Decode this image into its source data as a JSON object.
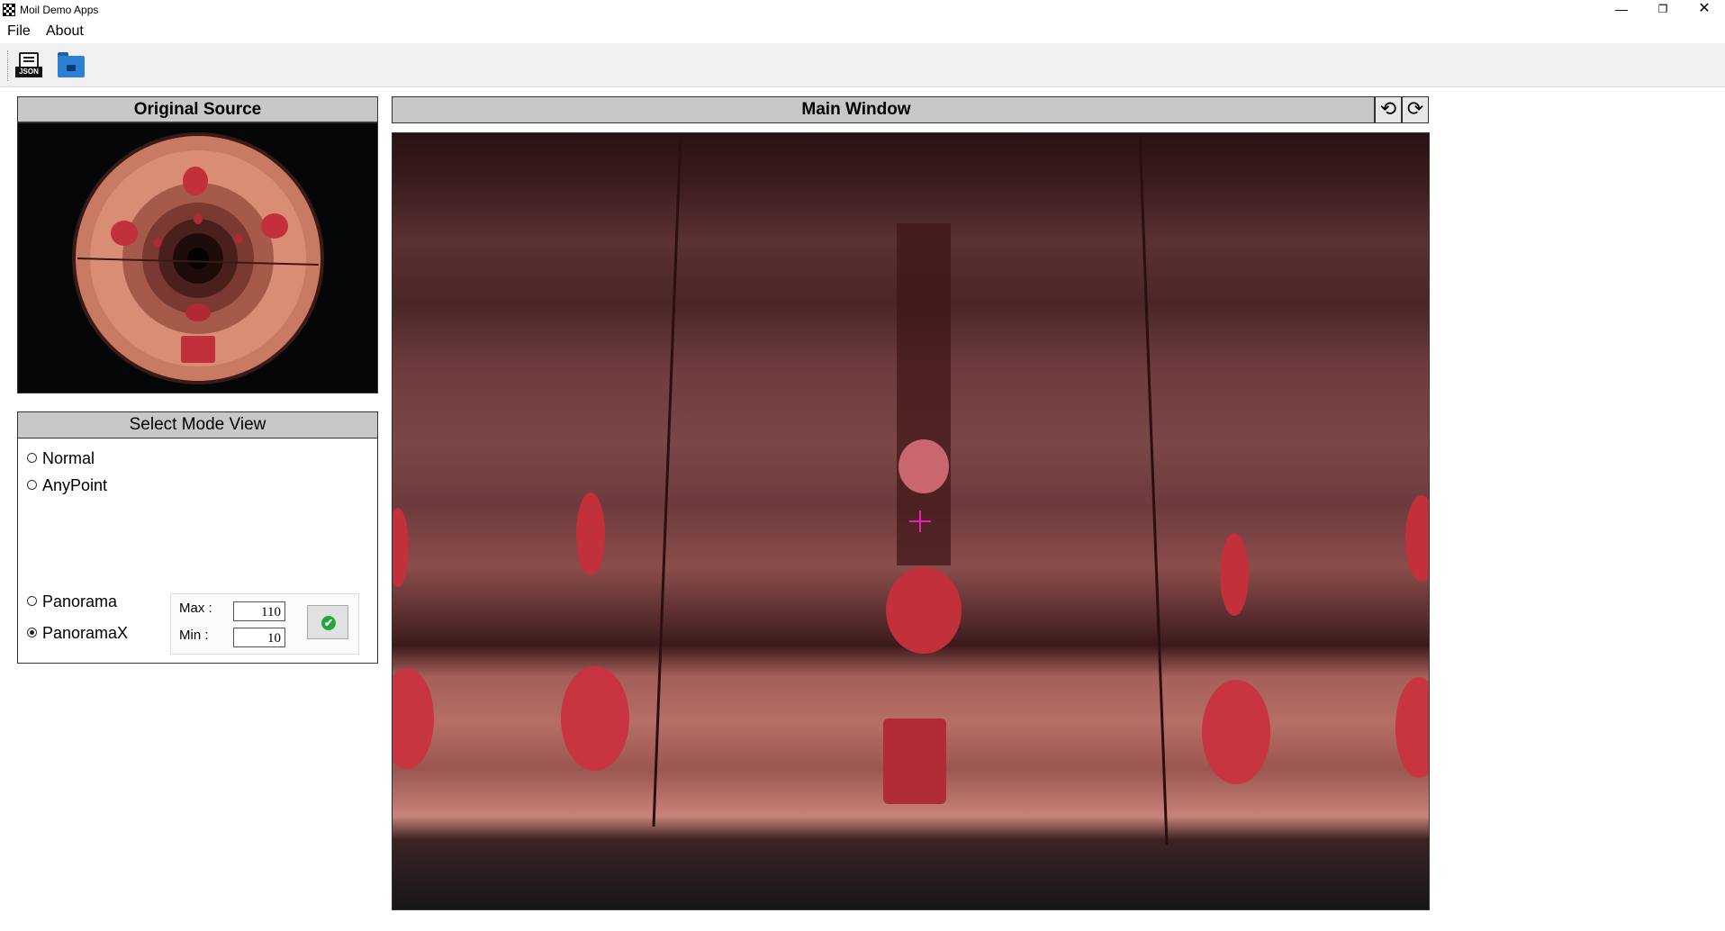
{
  "window": {
    "title": "Moil Demo Apps",
    "minimize": "—",
    "maximize": "❐",
    "close": "✕"
  },
  "menu": {
    "file": "File",
    "about": "About"
  },
  "toolbar": {
    "json_tag": "JSON",
    "json_icon": "json-file-icon",
    "open_icon": "open-folder-icon"
  },
  "original_source": {
    "title": "Original Source"
  },
  "mode_view": {
    "title": "Select Mode View",
    "options": [
      {
        "label": "Normal",
        "checked": false
      },
      {
        "label": "AnyPoint",
        "checked": false
      },
      {
        "label": "Panorama",
        "checked": false
      },
      {
        "label": "PanoramaX",
        "checked": true
      }
    ],
    "max_label": "Max :",
    "max_value": "110",
    "min_label": "Min :",
    "min_value": "10",
    "apply_icon": "check-circle-icon",
    "apply_symbol": "✔"
  },
  "main_window": {
    "title": "Main Window",
    "rotate_left_symbol": "⟲",
    "rotate_right_symbol": "⟳",
    "crosshair_color": "#e81fb9"
  },
  "colors": {
    "panel_header": "#c8c8c8",
    "apply_icon": "#22a83a",
    "folder_icon": "#2d7fd3"
  }
}
